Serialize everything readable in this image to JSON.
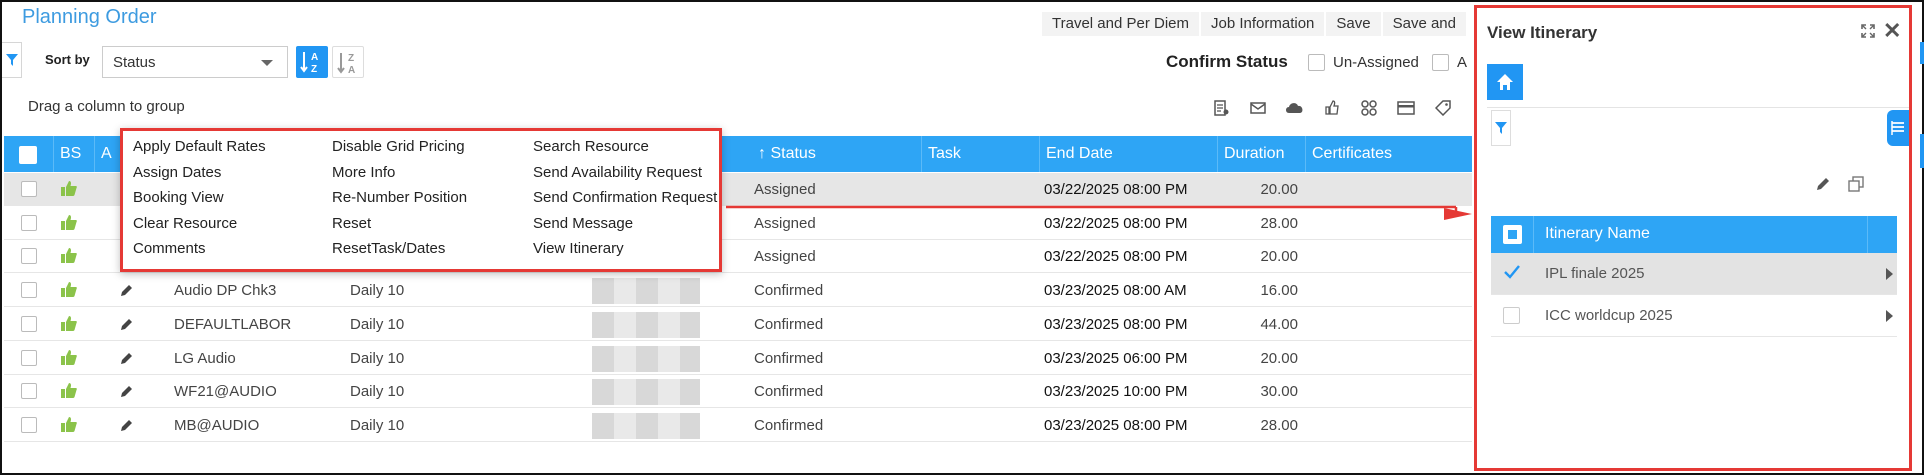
{
  "page": {
    "title": "Planning Order",
    "top_buttons": [
      "Travel and Per Diem",
      "Job Information",
      "Save",
      "Save and"
    ]
  },
  "toolbar": {
    "sort_by_label": "Sort by",
    "sort_value": "Status",
    "confirm_status_label": "Confirm Status",
    "options": [
      "Un-Assigned",
      "A"
    ],
    "drag_hint": "Drag a column to group",
    "icons": [
      "report-icon",
      "mail-icon",
      "cloud-icon",
      "thumbs-up-icon",
      "link-icon",
      "card-icon",
      "tag-icon",
      "more-icon"
    ]
  },
  "grid": {
    "columns": [
      "BS",
      "A",
      "Status",
      "Task",
      "End Date",
      "Duration",
      "Certificates"
    ],
    "status_sort_indicator": "↑",
    "rows": [
      {
        "name": "",
        "shift": "",
        "status": "Assigned",
        "end_date": "03/22/2025 08:00 PM",
        "duration": "20.00",
        "selected": true
      },
      {
        "name": "",
        "shift": "",
        "status": "Assigned",
        "end_date": "03/22/2025 08:00 PM",
        "duration": "28.00"
      },
      {
        "name": "",
        "shift": "",
        "status": "Assigned",
        "end_date": "03/22/2025 08:00 PM",
        "duration": "20.00"
      },
      {
        "name": "Audio DP Chk3",
        "shift": "Daily 10",
        "status": "Confirmed",
        "end_date": "03/23/2025 08:00 AM",
        "duration": "16.00"
      },
      {
        "name": "DEFAULTLABOR",
        "shift": "Daily 10",
        "status": "Confirmed",
        "end_date": "03/23/2025 08:00 PM",
        "duration": "44.00"
      },
      {
        "name": "LG Audio",
        "shift": "Daily 10",
        "status": "Confirmed",
        "end_date": "03/23/2025 06:00 PM",
        "duration": "20.00"
      },
      {
        "name": "WF21@AUDIO",
        "shift": "Daily 10",
        "status": "Confirmed",
        "end_date": "03/23/2025 10:00 PM",
        "duration": "30.00"
      },
      {
        "name": "MB@AUDIO",
        "shift": "Daily 10",
        "status": "Confirmed",
        "end_date": "03/23/2025 08:00 PM",
        "duration": "28.00"
      }
    ]
  },
  "context_menu": {
    "col1": [
      "Apply Default Rates",
      "Assign Dates",
      "Booking View",
      "Clear Resource",
      "Comments"
    ],
    "col2": [
      "Disable Grid Pricing",
      "More Info",
      "Re-Number Position",
      "Reset",
      "ResetTask/Dates"
    ],
    "col3": [
      "Search Resource",
      "Send Availability Request",
      "Send Confirmation Request",
      "Send Message",
      "View Itinerary"
    ]
  },
  "panel": {
    "title": "View Itinerary",
    "column_header": "Itinerary Name",
    "rows": [
      {
        "name": "IPL finale 2025",
        "checked": true
      },
      {
        "name": "ICC worldcup 2025",
        "checked": false
      }
    ]
  },
  "colors": {
    "accent": "#2196f3",
    "header": "#2ea5f5",
    "highlight": "#e53935",
    "thumb": "#8bc34a"
  }
}
